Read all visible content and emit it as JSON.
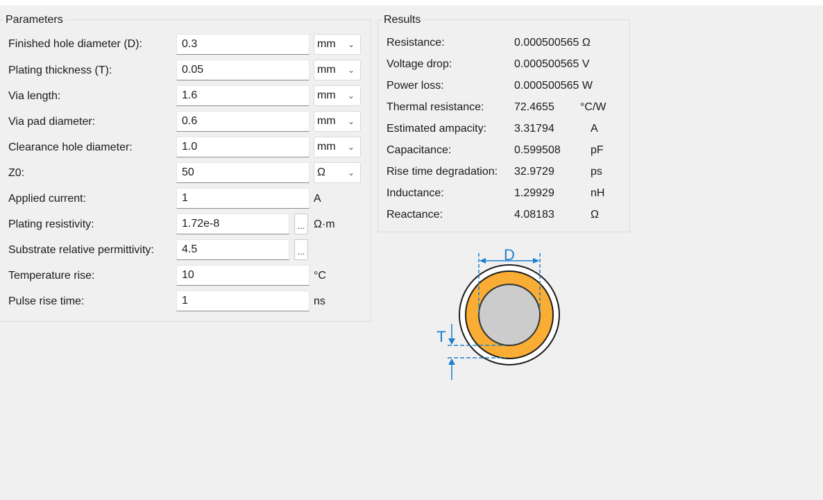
{
  "parameters": {
    "title": "Parameters",
    "rows": [
      {
        "label": "Finished hole diameter (D):",
        "value": "0.3",
        "unit": "mm"
      },
      {
        "label": "Plating thickness (T):",
        "value": "0.05",
        "unit": "mm"
      },
      {
        "label": "Via length:",
        "value": "1.6",
        "unit": "mm"
      },
      {
        "label": "Via pad diameter:",
        "value": "0.6",
        "unit": "mm"
      },
      {
        "label": "Clearance hole diameter:",
        "value": "1.0",
        "unit": "mm"
      },
      {
        "label": "Z0:",
        "value": "50",
        "unit": "Ω"
      },
      {
        "label": "Applied current:",
        "value": "1",
        "unit": "A"
      },
      {
        "label": "Plating resistivity:",
        "value": "1.72e-8",
        "unit": "Ω·m",
        "button": "..."
      },
      {
        "label": "Substrate relative permittivity:",
        "value": "4.5",
        "button": "..."
      },
      {
        "label": "Temperature rise:",
        "value": "10",
        "unit": "°C"
      },
      {
        "label": "Pulse rise time:",
        "value": "1",
        "unit": "ns"
      }
    ]
  },
  "results": {
    "title": "Results",
    "rows": [
      {
        "label": "Resistance:",
        "value": "0.000500565 Ω"
      },
      {
        "label": "Voltage drop:",
        "value": "0.000500565 V"
      },
      {
        "label": "Power loss:",
        "value": "0.000500565 W"
      },
      {
        "label": "Thermal resistance:",
        "value": "72.4655",
        "unit": "°C/W"
      },
      {
        "label": "Estimated ampacity:",
        "value": "3.31794",
        "unit": "A"
      },
      {
        "label": "Capacitance:",
        "value": "0.599508",
        "unit": "pF"
      },
      {
        "label": "Rise time degradation:",
        "value": "32.9729",
        "unit": "ps"
      },
      {
        "label": "Inductance:",
        "value": "1.29929",
        "unit": "nH"
      },
      {
        "label": "Reactance:",
        "value": "4.08183",
        "unit": "Ω"
      }
    ]
  },
  "diagram": {
    "label_d": "D",
    "label_t": "T",
    "colors": {
      "plating": "#f9ad35",
      "hole": "#cccccc",
      "dimension": "#1a7fd0",
      "outline": "#1a1a1a"
    }
  }
}
